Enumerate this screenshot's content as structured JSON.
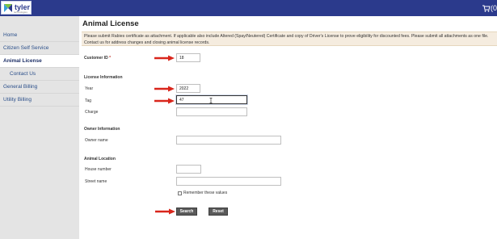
{
  "header": {
    "logo_text": "tyler",
    "logo_sub": "technologies",
    "cart_count": "(0"
  },
  "sidebar": {
    "items": [
      {
        "label": "Home"
      },
      {
        "label": "Citizen Self Service"
      },
      {
        "label": "Animal License"
      },
      {
        "label": "Contact Us"
      },
      {
        "label": "General Billing"
      },
      {
        "label": "Utility Billing"
      }
    ]
  },
  "main": {
    "title": "Animal License",
    "notice": "Please submit Rabies certificate as attachment. If applicable also include Altered (Spay/Neutered) Certificate and copy of Driver's License to prove eligibility for discounted fees. Please submit all attachments as one file. Contact us for address changes and closing animal license records.",
    "customer_id": {
      "label": "Customer ID",
      "required_mark": "*",
      "value": "18"
    },
    "license_section": "License Information",
    "year": {
      "label": "Year",
      "value": "2022"
    },
    "tag": {
      "label": "Tag",
      "value": "47"
    },
    "charge": {
      "label": "Charge",
      "value": ""
    },
    "owner_section": "Owner Information",
    "owner_name": {
      "label": "Owner name",
      "value": ""
    },
    "location_section": "Animal Location",
    "house_number": {
      "label": "House number",
      "value": ""
    },
    "street_name": {
      "label": "Street name",
      "value": ""
    },
    "remember_label": "Remember these values",
    "search_button": "Search",
    "reset_button": "Reset"
  },
  "colors": {
    "header_bg": "#2b3a8c",
    "sidebar_bg": "#e4e4e4",
    "notice_bg": "#f5ecdf",
    "arrow": "#d9261c",
    "button_bg": "#5a5a5a"
  }
}
